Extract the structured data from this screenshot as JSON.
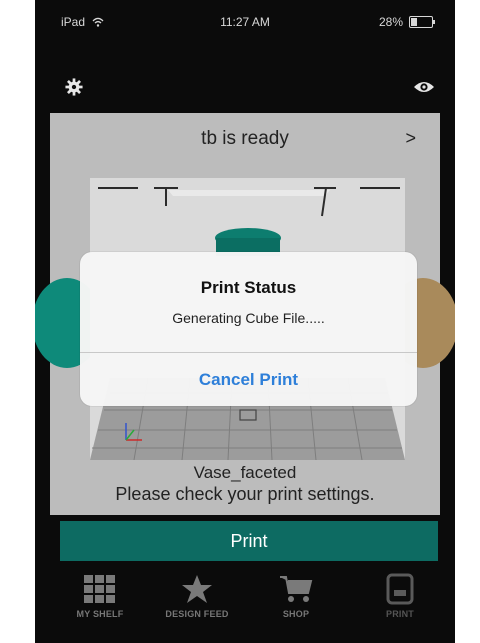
{
  "status_bar": {
    "carrier": "iPad",
    "time": "11:27 AM",
    "battery": "28%",
    "battery_level": 0.28
  },
  "printer": {
    "ready_text": "tb is ready"
  },
  "model": {
    "name": "Vase_faceted",
    "warning": "Please check your print settings."
  },
  "actions": {
    "print_label": "Print"
  },
  "dialog": {
    "title": "Print Status",
    "message": "Generating Cube File.....",
    "cancel_label": "Cancel Print"
  },
  "tabs": [
    {
      "label": "MY SHELF",
      "icon": "grid-icon"
    },
    {
      "label": "DESIGN FEED",
      "icon": "star-icon"
    },
    {
      "label": "SHOP",
      "icon": "cart-icon"
    },
    {
      "label": "PRINT",
      "icon": "printer-icon"
    }
  ],
  "colors": {
    "accent": "#0d6b62",
    "link": "#2e7fd9",
    "panel": "#bcbcbc",
    "background": "#0b0b0b"
  }
}
